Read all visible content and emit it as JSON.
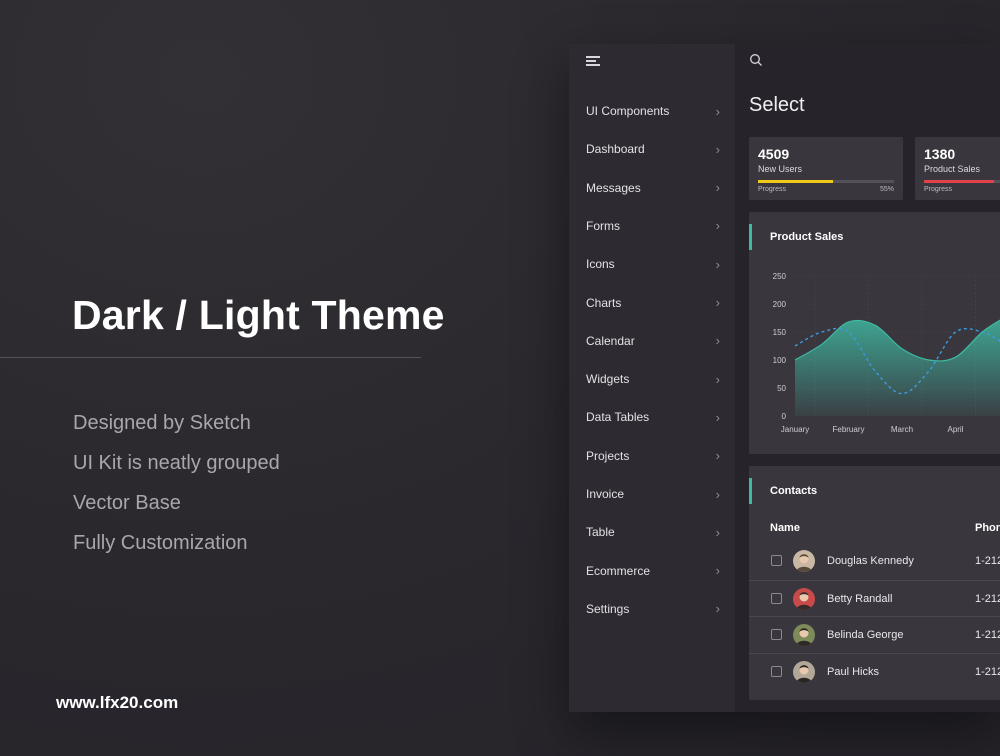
{
  "hero": {
    "title": "Dark / Light Theme",
    "features": [
      "Designed by Sketch",
      "UI Kit is neatly grouped",
      "Vector Base",
      "Fully Customization"
    ],
    "url": "www.lfx20.com"
  },
  "app": {
    "page_title": "Select",
    "sidebar": {
      "items": [
        {
          "label": "UI Components"
        },
        {
          "label": "Dashboard"
        },
        {
          "label": "Messages"
        },
        {
          "label": "Forms"
        },
        {
          "label": "Icons"
        },
        {
          "label": "Charts"
        },
        {
          "label": "Calendar"
        },
        {
          "label": "Widgets"
        },
        {
          "label": "Data Tables"
        },
        {
          "label": "Projects"
        },
        {
          "label": "Invoice"
        },
        {
          "label": "Table"
        },
        {
          "label": "Ecommerce"
        },
        {
          "label": "Settings"
        }
      ]
    },
    "stats": [
      {
        "value": "4509",
        "label": "New Users",
        "progress_label": "Progress",
        "percent_text": "55%",
        "progress": 0.55,
        "color": "#f2c81a"
      },
      {
        "value": "1380",
        "label": "Product Sales",
        "progress_label": "Progress",
        "percent_text": "",
        "progress": 0.85,
        "color": "#e0414a"
      }
    ],
    "chart_panel": {
      "title": "Product Sales"
    },
    "contacts": {
      "title": "Contacts",
      "col_name": "Name",
      "col_phone": "Phor",
      "rows": [
        {
          "name": "Douglas Kennedy",
          "phone": "1-212-"
        },
        {
          "name": "Betty Randall",
          "phone": "1-212-"
        },
        {
          "name": "Belinda George",
          "phone": "1-212-"
        },
        {
          "name": "Paul Hicks",
          "phone": "1-212-"
        }
      ]
    },
    "accent_color": "#3fb9a2"
  },
  "chart_data": {
    "type": "area",
    "title": "Product Sales",
    "categories": [
      "January",
      "February",
      "March",
      "April"
    ],
    "y_ticks": [
      0,
      50,
      100,
      150,
      200,
      250
    ],
    "ylim": [
      0,
      250
    ],
    "grid": true,
    "series": [
      {
        "style": "area",
        "color": "#3fb9a2",
        "x": [
          0,
          0.5,
          1,
          1.5,
          2,
          2.5,
          3,
          3.5,
          3.9
        ],
        "values": [
          100,
          128,
          168,
          162,
          120,
          100,
          105,
          150,
          175
        ]
      },
      {
        "style": "dashed-line",
        "color": "#3c9be0",
        "x": [
          0,
          0.5,
          1,
          1.5,
          2,
          2.5,
          3,
          3.5,
          3.9
        ],
        "values": [
          125,
          150,
          150,
          80,
          40,
          80,
          150,
          150,
          130
        ]
      }
    ]
  }
}
